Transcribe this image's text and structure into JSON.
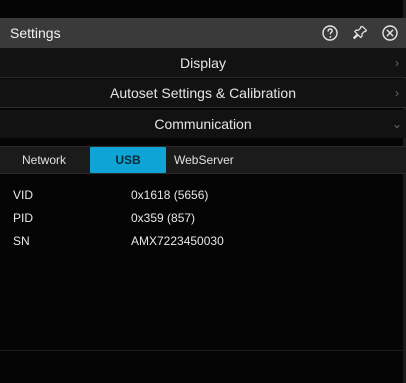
{
  "window": {
    "title": "Settings",
    "icons": {
      "help": "help-icon",
      "pin": "pin-icon",
      "close": "close-icon"
    }
  },
  "sections": [
    {
      "label": "Display",
      "expanded": false
    },
    {
      "label": "Autoset Settings & Calibration",
      "expanded": false
    },
    {
      "label": "Communication",
      "expanded": true
    }
  ],
  "communication": {
    "tabs": [
      {
        "label": "Network",
        "active": false
      },
      {
        "label": "USB",
        "active": true
      },
      {
        "label": "WebServer",
        "active": false
      }
    ],
    "usb_info": [
      {
        "key": "VID",
        "value": "0x1618 (5656)"
      },
      {
        "key": "PID",
        "value": "0x359 (857)"
      },
      {
        "key": "SN",
        "value": "AMX7223450030"
      }
    ]
  },
  "colors": {
    "accent": "#0ea4d6",
    "header_bg": "#3a3a3a",
    "panel_bg": "#050505"
  }
}
